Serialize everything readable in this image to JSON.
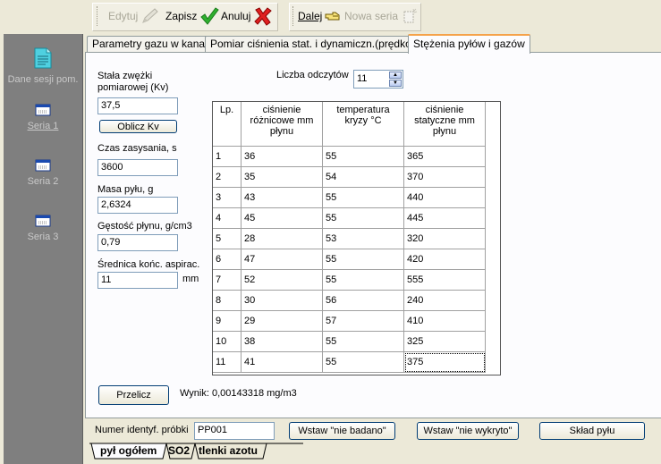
{
  "toolbar": {
    "edit": "Edytuj",
    "save": "Zapisz",
    "cancel": "Anuluj",
    "next": "Dalej",
    "new_series": "Nowa seria"
  },
  "sidebar": {
    "items": [
      {
        "label": "Dane sesji pom."
      },
      {
        "label": "Seria 1"
      },
      {
        "label": "Seria 2"
      },
      {
        "label": "Seria 3"
      }
    ]
  },
  "tabs": [
    {
      "label": "Parametry gazu w kanale"
    },
    {
      "label": "Pomiar ciśnienia stat. i dynamiczn.(prędkości)"
    },
    {
      "label": "Stężenia pyłów i gazów"
    }
  ],
  "form": {
    "kv_label": "Stała zwężki pomiarowej (Kv)",
    "kv_value": "37,5",
    "calc_kv_button": "Oblicz Kv",
    "suction_time_label": "Czas zasysania, s",
    "suction_time_value": "3600",
    "dust_mass_label": "Masa pyłu, g",
    "dust_mass_value": "2,6324",
    "density_label": "Gęstość płynu, g/cm3",
    "density_value": "0,79",
    "tip_diameter_label": "Średnica końc. aspirac.",
    "tip_diameter_value": "11",
    "tip_diameter_unit": "mm",
    "readings_label": "Liczba odczytów",
    "readings_value": "11",
    "recalc_button": "Przelicz",
    "result_text": "Wynik: 0,00143318 mg/m3"
  },
  "table": {
    "headers": [
      "Lp.",
      "ciśnienie różnicowe mm płynu",
      "temperatura kryzy °C",
      "ciśnienie statyczne mm płynu"
    ],
    "rows": [
      [
        "1",
        "36",
        "55",
        "365"
      ],
      [
        "2",
        "35",
        "54",
        "370"
      ],
      [
        "3",
        "43",
        "55",
        "440"
      ],
      [
        "4",
        "45",
        "55",
        "445"
      ],
      [
        "5",
        "28",
        "53",
        "320"
      ],
      [
        "6",
        "47",
        "55",
        "420"
      ],
      [
        "7",
        "52",
        "55",
        "555"
      ],
      [
        "8",
        "30",
        "56",
        "240"
      ],
      [
        "9",
        "29",
        "57",
        "410"
      ],
      [
        "10",
        "38",
        "55",
        "325"
      ],
      [
        "11",
        "41",
        "55",
        "375"
      ]
    ]
  },
  "bottom": {
    "sample_id_label": "Numer identyf. próbki",
    "sample_id_value": "PP001",
    "not_tested_button": "Wstaw \"nie badano\"",
    "not_detected_button": "Wstaw \"nie wykryto\"",
    "dust_composition_button": "Skład pyłu",
    "tabs": [
      {
        "label": "pył ogółem"
      },
      {
        "label": "SO2"
      },
      {
        "label": "tlenki azotu"
      }
    ]
  },
  "colors": {
    "active_tab_accent": "#f5a24a",
    "sidebar_bg": "#7f7f7f",
    "window_bg": "#ece9d8",
    "page_bg": "#fcfcfe"
  }
}
